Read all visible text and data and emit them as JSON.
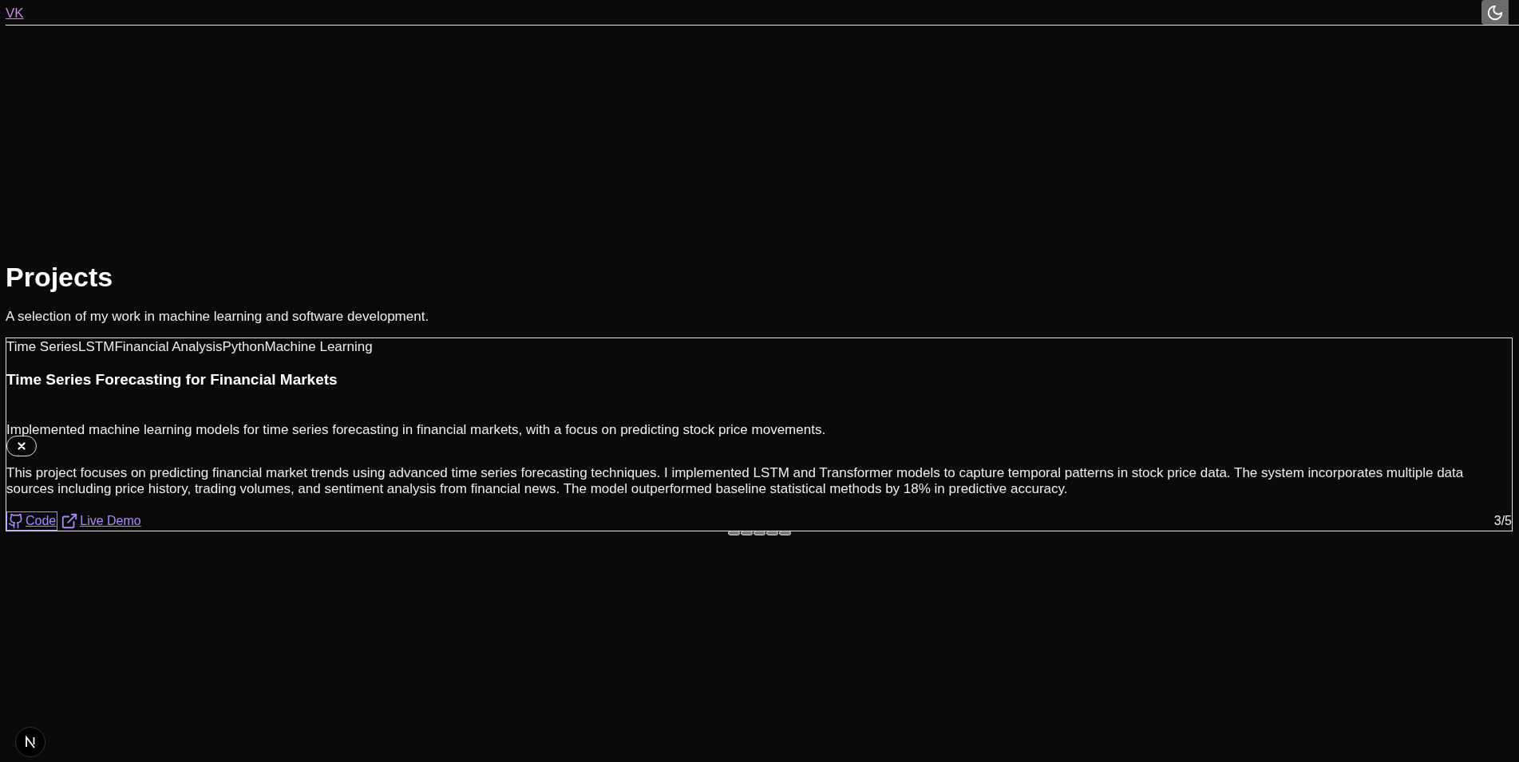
{
  "header": {
    "logo": "VK"
  },
  "section": {
    "title": "Projects",
    "subtitle": "A selection of my work in machine learning and software development."
  },
  "project": {
    "tags": [
      "Time Series",
      "LSTM",
      "Financial Analysis",
      "Python",
      "Machine Learning"
    ],
    "title": "Time Series Forecasting for Financial Markets",
    "summary": "Implemented machine learning models for time series forecasting in financial markets, with a focus on predicting stock price movements.",
    "description": "This project focuses on predicting financial market trends using advanced time series forecasting techniques. I implemented LSTM and Transformer models to capture temporal patterns in stock price data. The system incorporates multiple data sources including price history, trading volumes, and sentiment analysis from financial news. The model outperformed baseline statistical methods by 18% in predictive accuracy.",
    "links": [
      {
        "kind": "code",
        "label": "Code",
        "focused": true
      },
      {
        "kind": "demo",
        "label": "Live Demo",
        "focused": false
      }
    ],
    "counter": "3/5"
  },
  "dots": [
    {
      "selected": false
    },
    {
      "selected": false
    },
    {
      "selected": false
    },
    {
      "selected": false
    },
    {
      "selected": false
    }
  ]
}
